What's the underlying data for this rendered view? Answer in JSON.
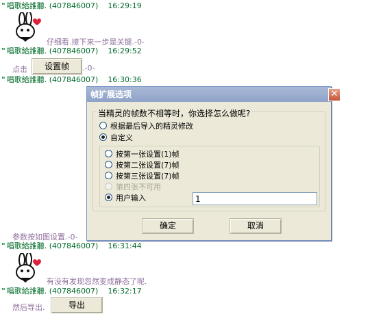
{
  "chat": {
    "sender": "唱歌給誰聽",
    "qq": "(407846007)",
    "messages": [
      {
        "time": "16:29:19",
        "text": "仔细看.接下来一步是关键.-0-"
      },
      {
        "time": "16:29:52",
        "prefix": "点击",
        "button": "设置帧",
        "suffix": ".-0-"
      },
      {
        "time": "16:30:36",
        "text": "参数按如图设置.-0-"
      },
      {
        "time": "16:31:44",
        "text": "有没有发现忽然变成静态了呢."
      },
      {
        "time": "16:32:17",
        "prefix": "然后导出.",
        "button": "导出"
      }
    ]
  },
  "dialog": {
    "title": "帧扩展选项",
    "close_glyph": "✕",
    "question": "当精灵的帧数不相等时，你选择怎么做呢?",
    "option_modify": "根据最后导入的精灵修改",
    "option_custom": "自定义",
    "sub_options": [
      {
        "label": "按第一张设置(1)帧",
        "checked": false,
        "disabled": false
      },
      {
        "label": "按第二张设置(7)帧",
        "checked": false,
        "disabled": false
      },
      {
        "label": "按第三张设置(7)帧",
        "checked": false,
        "disabled": false
      },
      {
        "label": "第四张不可用",
        "checked": false,
        "disabled": true
      },
      {
        "label": "用户输入",
        "checked": true,
        "disabled": false
      }
    ],
    "input_value": "1",
    "ok_label": "确定",
    "cancel_label": "取消"
  },
  "colors": {
    "sender": "#006b2a",
    "message": "#8f6f9c",
    "title_bar": "#8fa3c8"
  }
}
